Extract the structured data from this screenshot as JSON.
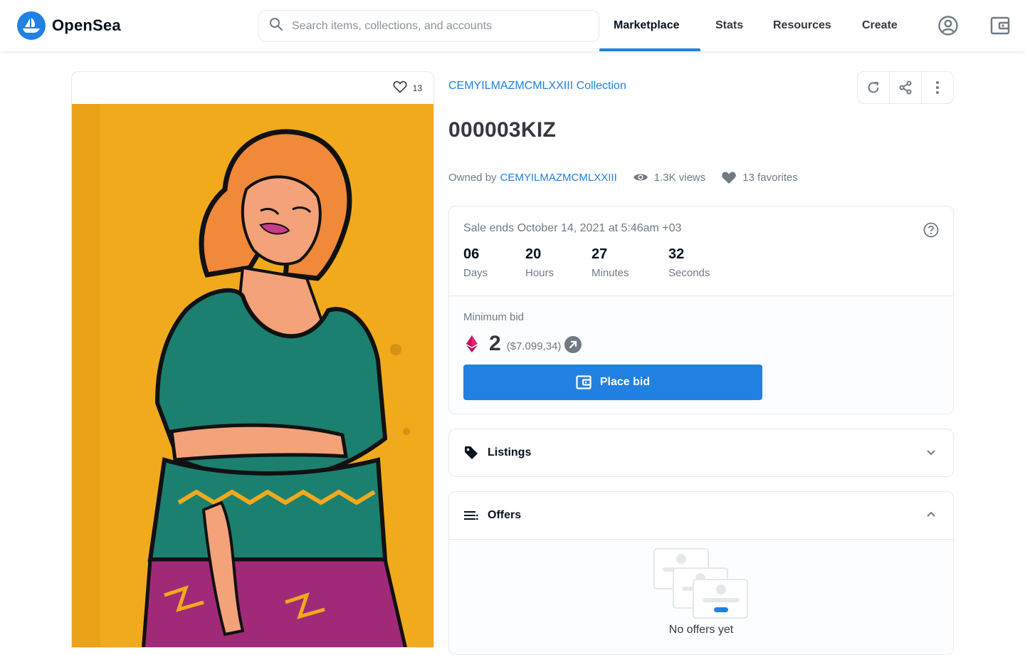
{
  "header": {
    "brand": "OpenSea",
    "search_placeholder": "Search items, collections, and accounts",
    "nav": [
      {
        "label": "Marketplace",
        "active": true
      },
      {
        "label": "Stats"
      },
      {
        "label": "Resources"
      },
      {
        "label": "Create"
      }
    ],
    "icons": [
      "search-icon",
      "account-icon",
      "wallet-icon"
    ],
    "accent": "#2081e2"
  },
  "asset": {
    "favorite_count": "13",
    "collection": "CEMYILMAZMCMLXXIII Collection",
    "name": "000003KIZ",
    "owned_by_label": "Owned by",
    "owner": "CEMYILMAZMCMLXXIII",
    "views": "1.3K views",
    "favorites": "13 favorites"
  },
  "sale": {
    "ends": "Sale ends October 14, 2021 at 5:46am +03",
    "countdown": [
      {
        "value": "06",
        "label": "Days"
      },
      {
        "value": "20",
        "label": "Hours"
      },
      {
        "value": "27",
        "label": "Minutes"
      },
      {
        "value": "32",
        "label": "Seconds"
      }
    ],
    "min_bid_label": "Minimum bid",
    "price": "2",
    "price_usd": "($7.099,34)",
    "place_bid_label": "Place bid"
  },
  "sections": {
    "listings": "Listings",
    "offers": "Offers",
    "no_offers": "No offers yet"
  }
}
